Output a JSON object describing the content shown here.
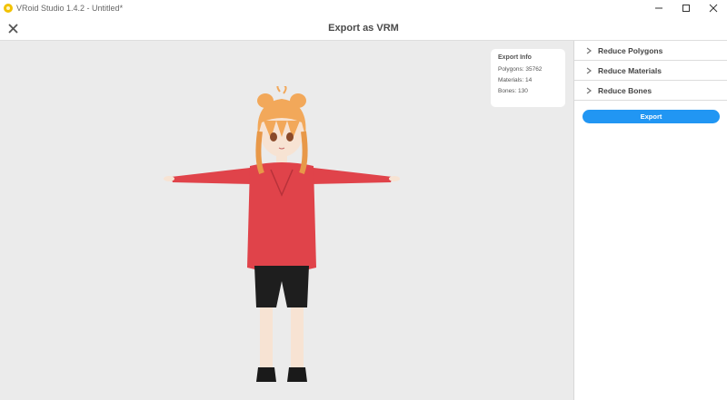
{
  "window": {
    "title": "VRoid Studio 1.4.2 - Untitled*",
    "controls": {
      "minimize": "minimize-icon",
      "maximize": "maximize-icon",
      "close": "close-icon"
    }
  },
  "header": {
    "close_icon": "close-icon",
    "title": "Export as VRM"
  },
  "export_info": {
    "heading": "Export Info",
    "polygons": "Polygons: 35762",
    "materials": "Materials: 14",
    "bones": "Bones: 130"
  },
  "sidebar": {
    "items": [
      {
        "label": "Reduce Polygons",
        "icon": "chevron-right-icon"
      },
      {
        "label": "Reduce Materials",
        "icon": "chevron-right-icon"
      },
      {
        "label": "Reduce Bones",
        "icon": "chevron-right-icon"
      }
    ],
    "export_label": "Export"
  },
  "colors": {
    "accent": "#2196f3",
    "viewport_bg": "#ebebeb",
    "hoodie": "#e0434a",
    "hair": "#f2a85a"
  }
}
